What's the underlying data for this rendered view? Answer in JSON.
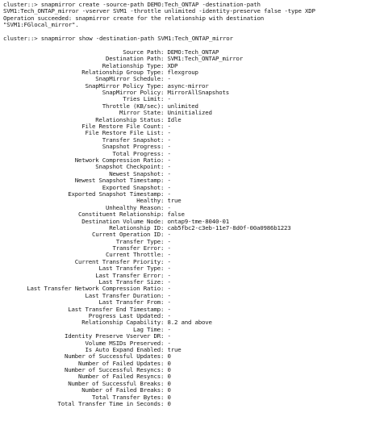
{
  "terminal": {
    "lines_top": [
      "cluster::> snapmirror create -source-path DEMO:Tech_ONTAP -destination-path",
      "SVM1:Tech_ONTAP_mirror -vserver SVM1 -throttle unlimited -identity-preserve false -type XDP",
      "Operation succeeded: snapmirror create for the relationship with destination",
      "\"SVM1:FGlocal_mirror\"."
    ],
    "command_show": "cluster::> snapmirror show -destination-path SVM1:Tech_ONTAP_mirror",
    "fields": [
      {
        "k": "Source Path",
        "v": "DEMO:Tech_ONTAP"
      },
      {
        "k": "Destination Path",
        "v": "SVM1:Tech_ONTAP_mirror"
      },
      {
        "k": "Relationship Type",
        "v": "XDP"
      },
      {
        "k": "Relationship Group Type",
        "v": "flexgroup"
      },
      {
        "k": "SnapMirror Schedule",
        "v": "-"
      },
      {
        "k": "SnapMirror Policy Type",
        "v": "async-mirror"
      },
      {
        "k": "SnapMirror Policy",
        "v": "MirrorAllSnapshots"
      },
      {
        "k": "Tries Limit",
        "v": "-"
      },
      {
        "k": "Throttle (KB/sec)",
        "v": "unlimited"
      },
      {
        "k": "Mirror State",
        "v": "Uninitialized"
      },
      {
        "k": "Relationship Status",
        "v": "Idle"
      },
      {
        "k": "File Restore File Count",
        "v": "-"
      },
      {
        "k": "File Restore File List",
        "v": "-"
      },
      {
        "k": "Transfer Snapshot",
        "v": "-"
      },
      {
        "k": "Snapshot Progress",
        "v": "-"
      },
      {
        "k": "Total Progress",
        "v": "-"
      },
      {
        "k": "Network Compression Ratio",
        "v": "-"
      },
      {
        "k": "Snapshot Checkpoint",
        "v": "-"
      },
      {
        "k": "Newest Snapshot",
        "v": "-"
      },
      {
        "k": "Newest Snapshot Timestamp",
        "v": "-"
      },
      {
        "k": "Exported Snapshot",
        "v": "-"
      },
      {
        "k": "Exported Snapshot Timestamp",
        "v": "-"
      },
      {
        "k": "Healthy",
        "v": "true"
      },
      {
        "k": "Unhealthy Reason",
        "v": "-"
      },
      {
        "k": "Constituent Relationship",
        "v": "false"
      },
      {
        "k": "Destination Volume Node",
        "v": "ontap9-tme-8040-01"
      },
      {
        "k": "Relationship ID",
        "v": "cab5fbc2-c3eb-11e7-8d0f-00a0986b1223"
      },
      {
        "k": "Current Operation ID",
        "v": "-"
      },
      {
        "k": "Transfer Type",
        "v": "-"
      },
      {
        "k": "Transfer Error",
        "v": "-"
      },
      {
        "k": "Current Throttle",
        "v": "-"
      },
      {
        "k": "Current Transfer Priority",
        "v": "-"
      },
      {
        "k": "Last Transfer Type",
        "v": "-"
      },
      {
        "k": "Last Transfer Error",
        "v": "-"
      },
      {
        "k": "Last Transfer Size",
        "v": "-"
      },
      {
        "k": "Last Transfer Network Compression Ratio",
        "v": "-"
      },
      {
        "k": "Last Transfer Duration",
        "v": "-"
      },
      {
        "k": "Last Transfer From",
        "v": "-"
      },
      {
        "k": "Last Transfer End Timestamp",
        "v": "-"
      },
      {
        "k": "Progress Last Updated",
        "v": "-"
      },
      {
        "k": "Relationship Capability",
        "v": "8.2 and above"
      },
      {
        "k": "Lag Time",
        "v": "-"
      },
      {
        "k": "Identity Preserve Vserver DR",
        "v": "-"
      },
      {
        "k": "Volume MSIDs Preserved",
        "v": "-"
      },
      {
        "k": "Is Auto Expand Enabled",
        "v": "true"
      },
      {
        "k": "Number of Successful Updates",
        "v": "0"
      },
      {
        "k": "Number of Failed Updates",
        "v": "0"
      },
      {
        "k": "Number of Successful Resyncs",
        "v": "0"
      },
      {
        "k": "Number of Failed Resyncs",
        "v": "0"
      },
      {
        "k": "Number of Successful Breaks",
        "v": "0"
      },
      {
        "k": "Number of Failed Breaks",
        "v": "0"
      },
      {
        "k": "Total Transfer Bytes",
        "v": "0"
      },
      {
        "k": "Total Transfer Time in Seconds",
        "v": "0"
      }
    ]
  }
}
